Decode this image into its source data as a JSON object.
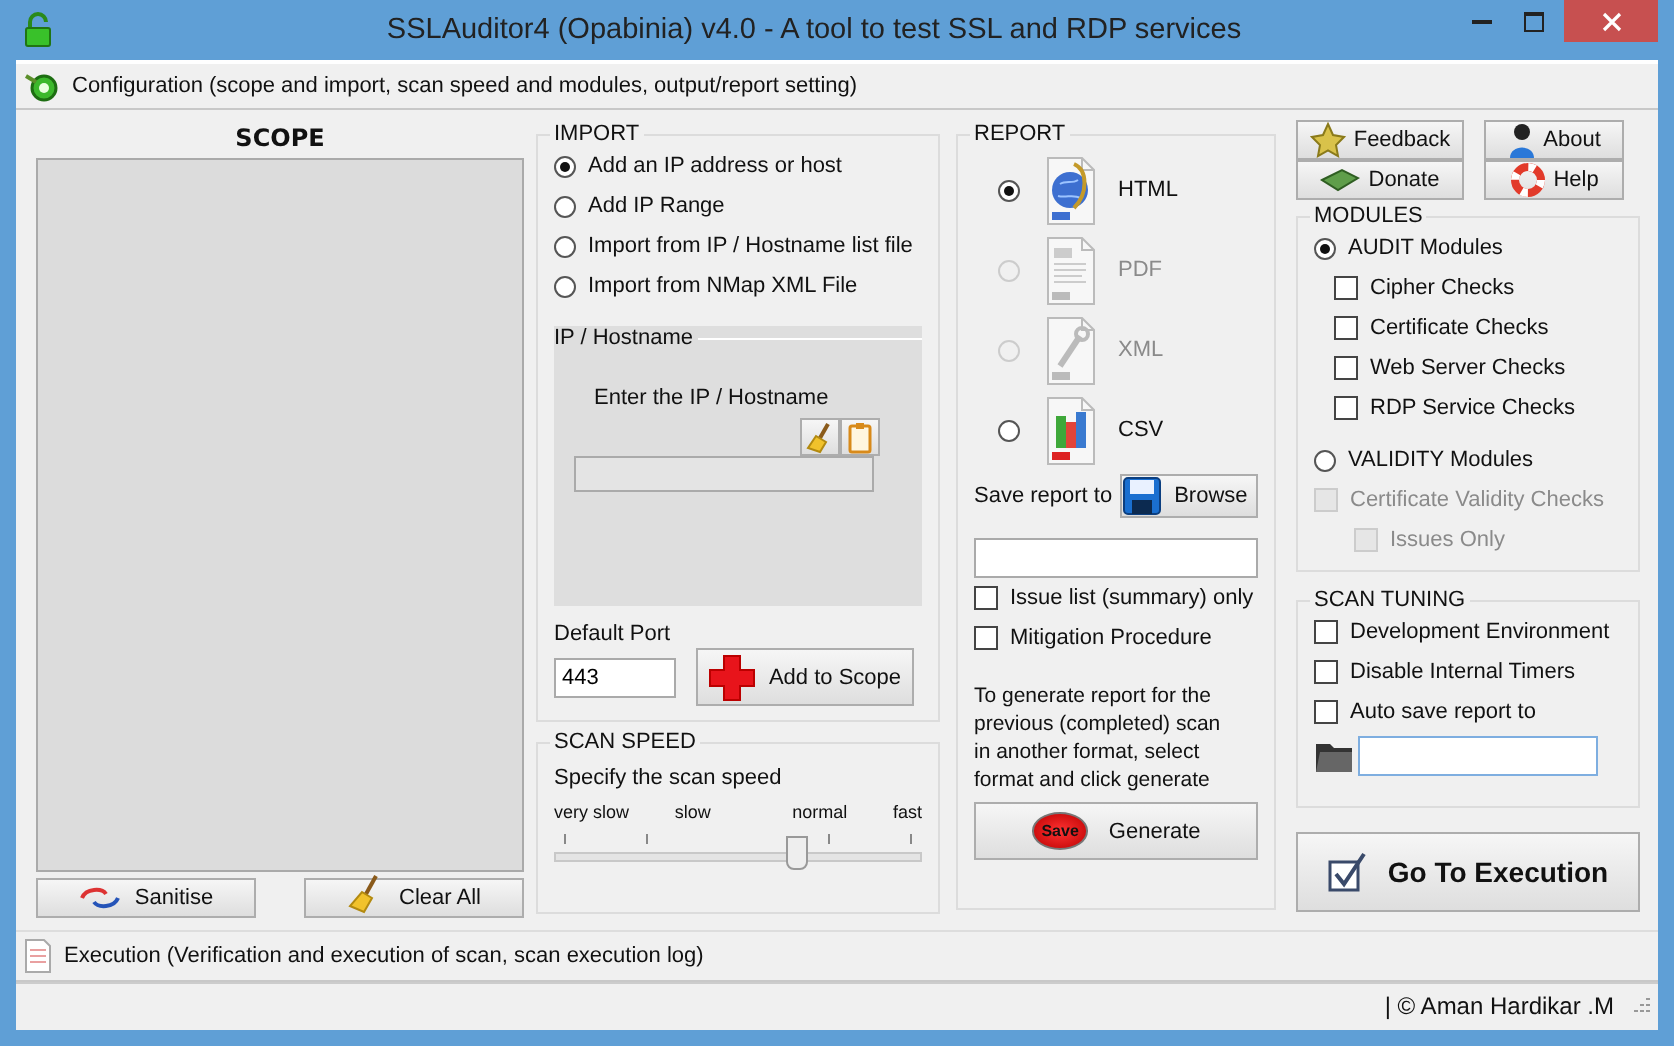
{
  "window": {
    "title": "SSLAuditor4 (Opabinia) v4.0 - A tool to test SSL and RDP services"
  },
  "config_bar": {
    "label": "Configuration (scope and import, scan speed and modules, output/report setting)"
  },
  "scope": {
    "title": "SCOPE",
    "buttons": [
      {
        "label": "Sanitise",
        "kind": "sanitise"
      },
      {
        "label": "Clear All",
        "kind": "broom"
      }
    ]
  },
  "import": {
    "title": "IMPORT",
    "options": [
      {
        "label": "Add an IP address or host",
        "selected": true
      },
      {
        "label": "Add IP Range",
        "selected": false
      },
      {
        "label": "Import from IP / Hostname list file",
        "selected": false
      },
      {
        "label": "Import from NMap XML File",
        "selected": false
      }
    ],
    "ip_group": {
      "title": "IP / Hostname",
      "prompt": "Enter the IP / Hostname"
    },
    "default_port": {
      "label": "Default Port",
      "value": "443"
    },
    "add_button": {
      "label": "Add to Scope"
    }
  },
  "scan_speed": {
    "title": "SCAN SPEED",
    "prompt": "Specify the scan speed",
    "ticks": [
      "very slow",
      "slow",
      "normal",
      "fast"
    ],
    "level": 0.66
  },
  "report": {
    "title": "REPORT",
    "formats": [
      {
        "label": "HTML",
        "kind": "html",
        "selected": true,
        "disabled": false
      },
      {
        "label": "PDF",
        "kind": "pdf",
        "selected": false,
        "disabled": true
      },
      {
        "label": "XML",
        "kind": "xml",
        "selected": false,
        "disabled": true
      },
      {
        "label": "CSV",
        "kind": "csv",
        "selected": false,
        "disabled": false
      }
    ],
    "save_label": "Save report to",
    "browse_button": {
      "label": "Browse"
    },
    "options": [
      {
        "label": "Issue list (summary) only",
        "checked": false
      },
      {
        "label": "Mitigation Procedure",
        "checked": false
      }
    ],
    "note": "To generate report for the previous (completed) scan in another format, select format and click generate",
    "generate_button": {
      "label": "Generate",
      "icon_label": "Save"
    }
  },
  "top_buttons": [
    {
      "label": "Feedback",
      "kind": "star"
    },
    {
      "label": "About",
      "kind": "person"
    },
    {
      "label": "Donate",
      "kind": "money"
    },
    {
      "label": "Help",
      "kind": "lifebuoy"
    }
  ],
  "modules": {
    "title": "MODULES",
    "audit": {
      "label": "AUDIT Modules",
      "selected": true
    },
    "audit_checks": [
      {
        "label": "Cipher Checks",
        "checked": false
      },
      {
        "label": "Certificate Checks",
        "checked": false
      },
      {
        "label": "Web Server Checks",
        "checked": false
      },
      {
        "label": "RDP Service Checks",
        "checked": false
      }
    ],
    "validity": {
      "label": "VALIDITY Modules",
      "selected": false
    },
    "validity_checks": [
      {
        "label": "Certificate Validity Checks",
        "checked": false,
        "disabled": true,
        "children": [
          {
            "label": "Issues Only",
            "checked": false,
            "disabled": true
          }
        ]
      }
    ]
  },
  "scan_tuning": {
    "title": "SCAN TUNING",
    "options": [
      {
        "label": "Development Environment",
        "checked": false
      },
      {
        "label": "Disable Internal Timers",
        "checked": false
      },
      {
        "label": "Auto save report to",
        "checked": false
      }
    ]
  },
  "go_button": {
    "label": "Go To Execution"
  },
  "execution_bar": {
    "label": "Execution (Verification and execution of scan, scan execution log)"
  },
  "status_bar": {
    "text": "| © Aman Hardikar .M"
  }
}
